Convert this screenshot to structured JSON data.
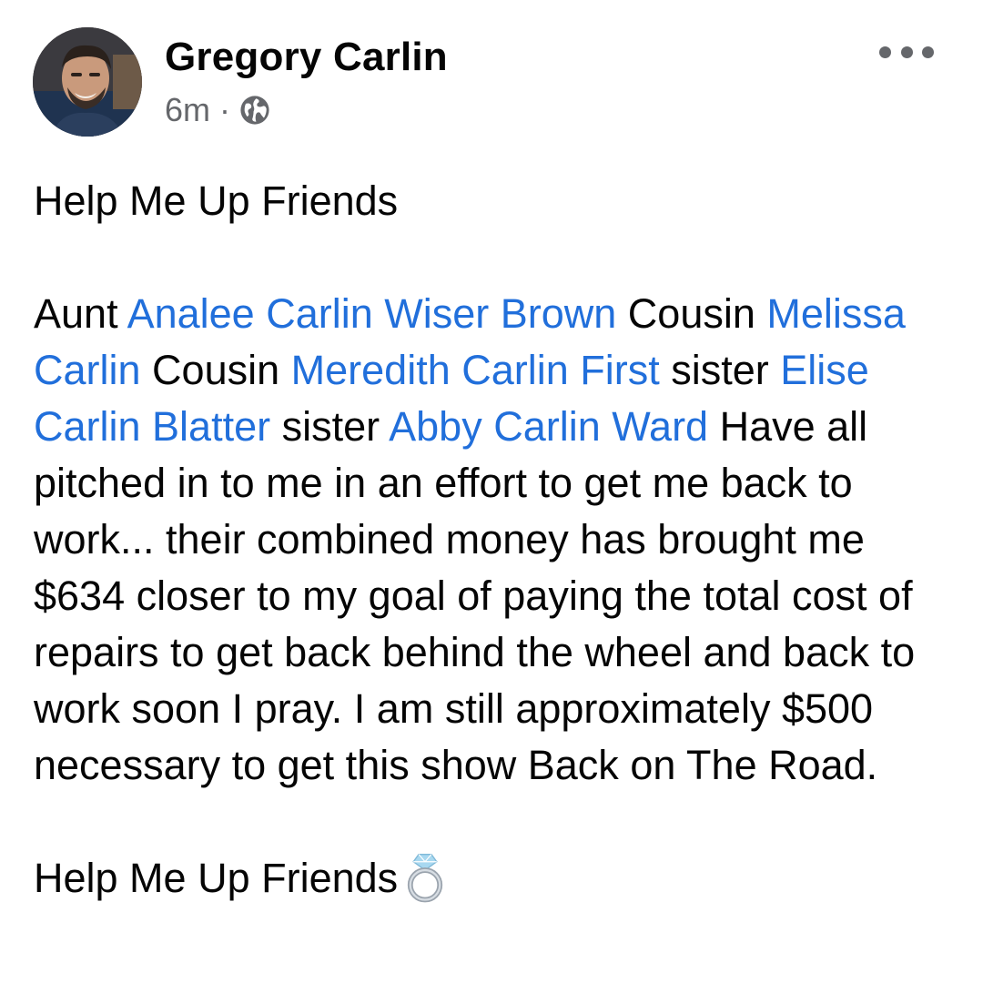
{
  "post": {
    "author_name": "Gregory Carlin",
    "timestamp": "6m",
    "separator": "·",
    "privacy_icon": "globe-icon",
    "more_icon": "more-horizontal-icon",
    "heading": "Help Me Up Friends",
    "body": {
      "t1": "Aunt ",
      "m1": "Analee Carlin Wiser Brown",
      "t2": " Cousin ",
      "m2": "Melissa Carlin",
      "t3": " Cousin ",
      "m3": "Meredith Carlin First",
      "t4": " sister ",
      "m4": "Elise Carlin Blatter",
      "t5": " sister ",
      "m5": "Abby Carlin Ward",
      "t6": " Have all pitched in to me in an effort to get me back to work... their combined money has brought me $634 closer to my goal of paying the total cost of repairs to get back behind the wheel and back to work soon I pray. I am still approximately $500 necessary to get this show Back on The Road."
    },
    "closing": "Help Me Up Friends",
    "closing_icon": "ring-icon",
    "colors": {
      "mention": "#216fdb",
      "meta": "#65676b",
      "text": "#050505"
    }
  }
}
